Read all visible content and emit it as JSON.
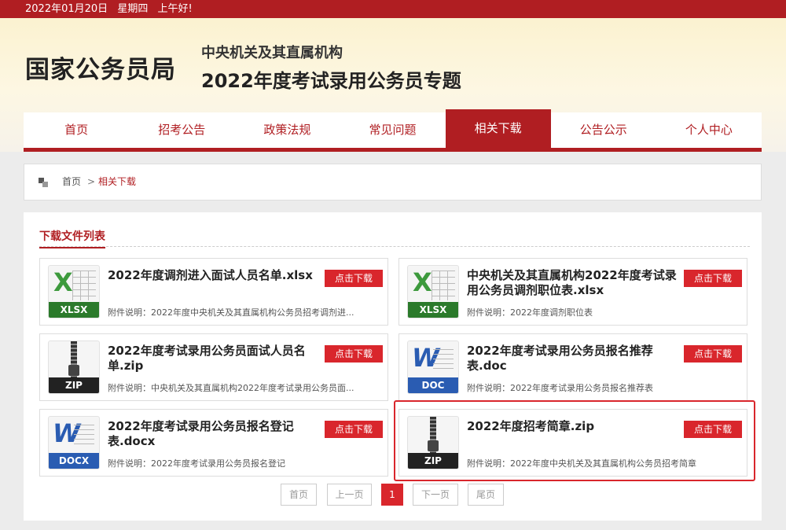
{
  "topbar": {
    "date": "2022年01月20日",
    "weekday": "星期四",
    "greeting": "上午好!"
  },
  "header": {
    "logo": "国家公务员局",
    "subtitle1": "中央机关及其直属机构",
    "subtitle2": "2022年度考试录用公务员专题"
  },
  "nav": [
    {
      "label": "首页"
    },
    {
      "label": "招考公告"
    },
    {
      "label": "政策法规"
    },
    {
      "label": "常见问题"
    },
    {
      "label": "相关下载"
    },
    {
      "label": "公告公示"
    },
    {
      "label": "个人中心"
    }
  ],
  "nav_active_index": 4,
  "breadcrumb": {
    "home": "首页",
    "separator": ">",
    "current": "相关下载"
  },
  "panel_title": "下载文件列表",
  "download_label": "点击下载",
  "files": [
    {
      "name": "2022年度调剂进入面试人员名单.xlsx",
      "type_badge": "XLSX",
      "desc": "附件说明：2022年度中央机关及其直属机构公务员招考调剂进..."
    },
    {
      "name": "中央机关及其直属机构2022年度考试录用公务员调剂职位表.xlsx",
      "type_badge": "XLSX",
      "desc": "附件说明：2022年度调剂职位表"
    },
    {
      "name": "2022年度考试录用公务员面试人员名单.zip",
      "type_badge": "ZIP",
      "desc": "附件说明：中央机关及其直属机构2022年度考试录用公务员面..."
    },
    {
      "name": "2022年度考试录用公务员报名推荐表.doc",
      "type_badge": "DOC",
      "desc": "附件说明：2022年度考试录用公务员报名推荐表"
    },
    {
      "name": "2022年度考试录用公务员报名登记表.docx",
      "type_badge": "DOCX",
      "desc": "附件说明：2022年度考试录用公务员报名登记"
    },
    {
      "name": "2022年度招考简章.zip",
      "type_badge": "ZIP",
      "desc": "附件说明：2022年度中央机关及其直属机构公务员招考简章"
    }
  ],
  "pagination": {
    "first": "首页",
    "prev": "上一页",
    "current": "1",
    "next": "下一页",
    "last": "尾页"
  },
  "colors": {
    "brand_red": "#b01e22",
    "button_red": "#d9262c"
  }
}
